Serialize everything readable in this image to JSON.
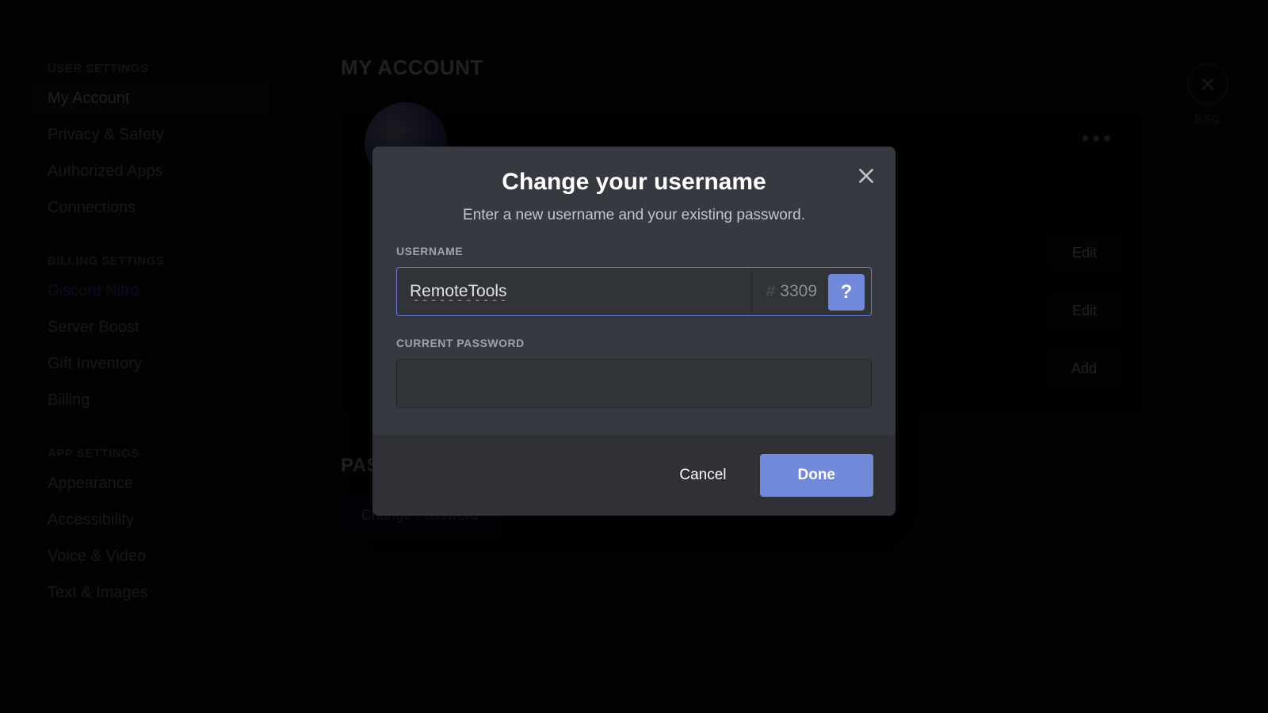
{
  "sidebar": {
    "sections": [
      {
        "header": "USER SETTINGS",
        "items": [
          {
            "label": "My Account",
            "selected": true
          },
          {
            "label": "Privacy & Safety"
          },
          {
            "label": "Authorized Apps"
          },
          {
            "label": "Connections"
          }
        ]
      },
      {
        "header": "BILLING SETTINGS",
        "items": [
          {
            "label": "Discord Nitro",
            "nitro": true
          },
          {
            "label": "Server Boost"
          },
          {
            "label": "Gift Inventory"
          },
          {
            "label": "Billing"
          }
        ]
      },
      {
        "header": "APP SETTINGS",
        "items": [
          {
            "label": "Appearance"
          },
          {
            "label": "Accessibility"
          },
          {
            "label": "Voice & Video"
          },
          {
            "label": "Text & Images"
          }
        ]
      }
    ]
  },
  "close": {
    "esc": "ESC"
  },
  "page": {
    "title": "MY ACCOUNT",
    "edit_label": "Edit",
    "add_label": "Add",
    "pw_section": "PASSWORD AND AUTHENTICATION",
    "change_pw_btn": "Change Password"
  },
  "modal": {
    "title": "Change your username",
    "subtitle": "Enter a new username and your existing password.",
    "username_label": "USERNAME",
    "username_value": "RemoteTools",
    "discriminator": "3309",
    "password_label": "CURRENT PASSWORD",
    "password_value": "",
    "help_glyph": "?",
    "cancel": "Cancel",
    "done": "Done"
  }
}
